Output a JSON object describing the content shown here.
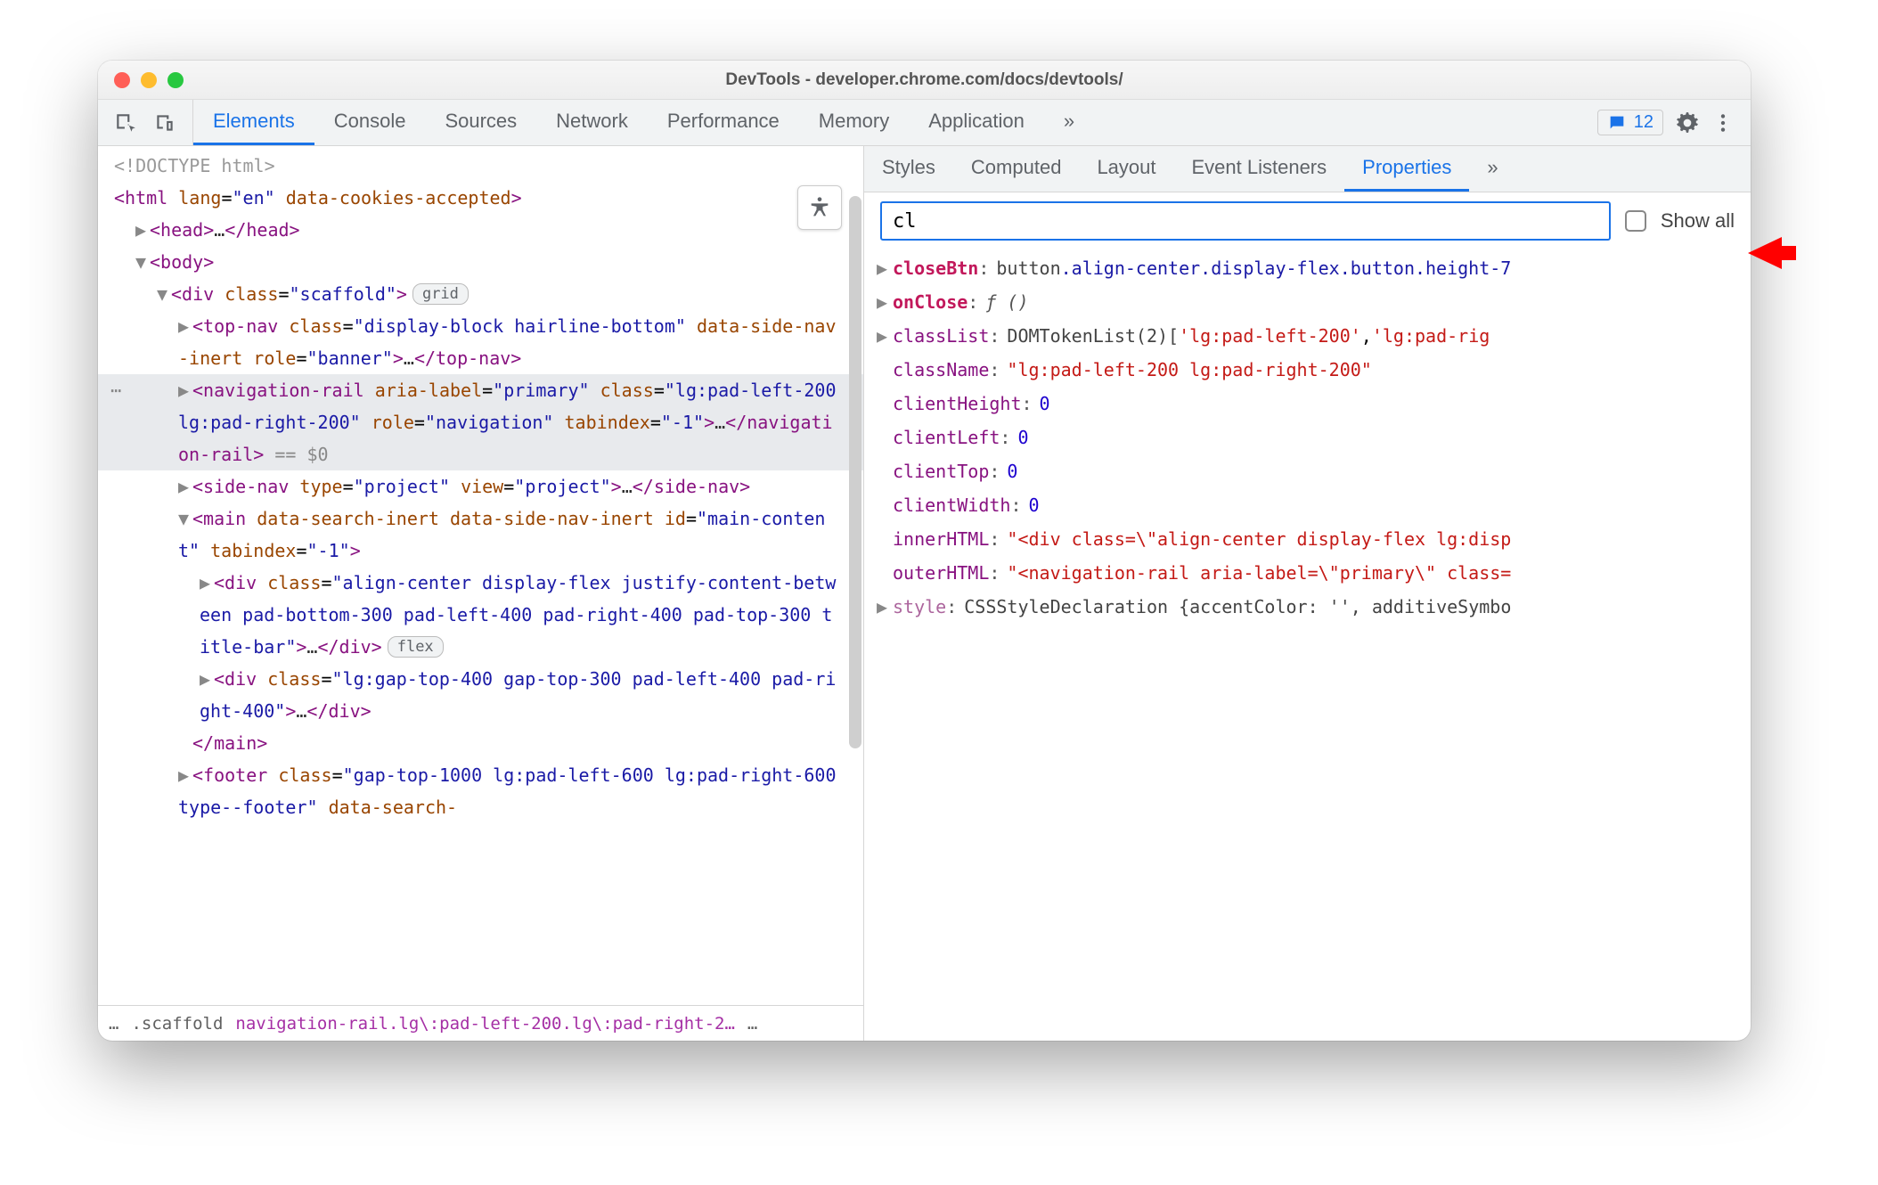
{
  "window_title": "DevTools - developer.chrome.com/docs/devtools/",
  "toolbar": {
    "tabs": [
      "Elements",
      "Console",
      "Sources",
      "Network",
      "Performance",
      "Memory",
      "Application"
    ],
    "active_tab": "Elements",
    "issues_count": "12"
  },
  "accessibility_button": "accessibility",
  "dom": {
    "doctype": "<!DOCTYPE html>",
    "html_open": {
      "tag": "html",
      "attrs": [
        [
          "lang",
          "en"
        ]
      ],
      "bool_attrs": [
        "data-cookies-accepted"
      ]
    },
    "head": "<head>…</head>",
    "body": "<body>",
    "scaffold": {
      "tag": "div",
      "attrs": [
        [
          "class",
          "scaffold"
        ]
      ],
      "badge": "grid"
    },
    "topnav": {
      "tag": "top-nav",
      "attrs": [
        [
          "class",
          "display-block hairline-bottom"
        ],
        [
          "role",
          "banner"
        ]
      ],
      "bool_attrs": [
        "data-side-nav-inert"
      ],
      "ellipsis": true
    },
    "navrail": {
      "tag": "navigation-rail",
      "attrs": [
        [
          "aria-label",
          "primary"
        ],
        [
          "class",
          "lg:pad-left-200 lg:pad-right-200"
        ],
        [
          "role",
          "navigation"
        ],
        [
          "tabindex",
          "-1"
        ]
      ],
      "selected": true
    },
    "sidenav": {
      "tag": "side-nav",
      "attrs": [
        [
          "type",
          "project"
        ],
        [
          "view",
          "project"
        ]
      ],
      "ellipsis": true
    },
    "main_el": {
      "tag": "main",
      "attrs": [
        [
          "id",
          "main-content"
        ],
        [
          "tabindex",
          "-1"
        ]
      ],
      "bool_attrs": [
        "data-search-inert",
        "data-side-nav-inert"
      ]
    },
    "div1": {
      "tag": "div",
      "attrs": [
        [
          "class",
          "align-center display-flex justify-content-between pad-bottom-300 pad-left-400 pad-right-400 pad-top-300 title-bar"
        ]
      ],
      "badge": "flex"
    },
    "div2": {
      "tag": "div",
      "attrs": [
        [
          "class",
          "lg:gap-top-400 gap-top-300 pad-left-400 pad-right-400"
        ]
      ]
    },
    "footer": {
      "tag": "footer",
      "attrs": [
        [
          "class",
          "gap-top-1000 lg:pad-left-600 lg:pad-right-600 type--footer"
        ]
      ],
      "bool_attrs": [
        "data-search-"
      ]
    }
  },
  "breadcrumb": {
    "items": [
      ".scaffold",
      "navigation-rail.lg\\:pad-left-200.lg\\:pad-right-2…"
    ]
  },
  "sidebar": {
    "tabs": [
      "Styles",
      "Computed",
      "Layout",
      "Event Listeners",
      "Properties"
    ],
    "active_tab": "Properties",
    "filter_value": "cl",
    "show_all_label": "Show all",
    "show_all_checked": false
  },
  "properties": [
    {
      "name": "closeBtn",
      "bold": true,
      "arrow": true,
      "value_type": "selector",
      "value": "button.align-center.display-flex.button.height-7"
    },
    {
      "name": "onClose",
      "bold": true,
      "arrow": true,
      "value_type": "func",
      "value": "ƒ ()"
    },
    {
      "name": "classList",
      "arrow": true,
      "value_type": "tokenlist",
      "value": "DOMTokenList(2) ['lg:pad-left-200', 'lg:pad-rig"
    },
    {
      "name": "className",
      "value_type": "string",
      "value": "\"lg:pad-left-200 lg:pad-right-200\""
    },
    {
      "name": "clientHeight",
      "value_type": "number",
      "value": "0"
    },
    {
      "name": "clientLeft",
      "value_type": "number",
      "value": "0"
    },
    {
      "name": "clientTop",
      "value_type": "number",
      "value": "0"
    },
    {
      "name": "clientWidth",
      "value_type": "number",
      "value": "0"
    },
    {
      "name": "innerHTML",
      "value_type": "string",
      "value": "\"<div class=\\\"align-center display-flex lg:disp"
    },
    {
      "name": "outerHTML",
      "value_type": "string",
      "value": "\"<navigation-rail aria-label=\\\"primary\\\" class="
    },
    {
      "name": "style",
      "arrow": true,
      "value_type": "decl",
      "value": "CSSStyleDeclaration {accentColor: '', additiveSymbo"
    }
  ]
}
